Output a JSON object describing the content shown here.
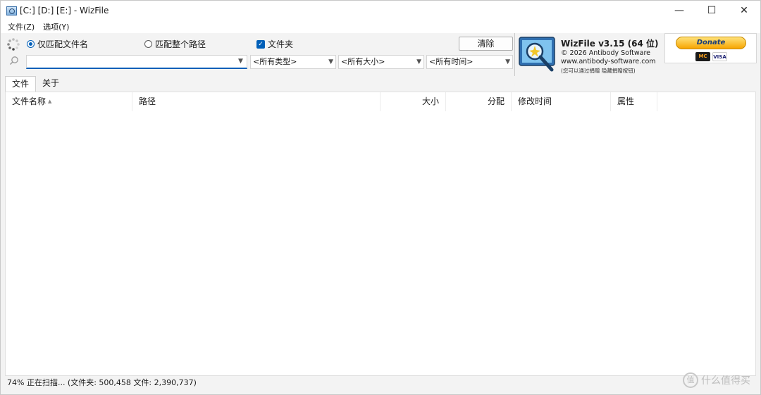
{
  "window": {
    "title": "[C:] [D:] [E:]  - WizFile",
    "controls": {
      "minimize": "—",
      "maximize": "☐",
      "close": "✕"
    }
  },
  "menu": {
    "items": [
      "文件(Z)",
      "选项(Y)"
    ]
  },
  "toolbar": {
    "radio_filename": "仅匹配文件名",
    "radio_fullpath": "匹配整个路径",
    "radio_selected": "filename",
    "folders_label": "文件夹",
    "folders_checked": true,
    "clear_button": "清除",
    "search_value": "",
    "filter_type": "<所有类型>",
    "filter_size": "<所有大小>",
    "filter_time": "<所有时间>"
  },
  "banner": {
    "title": "WizFile v3.15 (64 位)",
    "copyright": "© 2026 Antibody Software",
    "url": "www.antibody-software.com",
    "note": "(您可以通过捐赠 隐藏捐赠按钮)"
  },
  "donate": {
    "label": "Donate",
    "card1": "MC",
    "card2": "VISA"
  },
  "tabs": [
    {
      "label": "文件",
      "active": true
    },
    {
      "label": "关于",
      "active": false
    }
  ],
  "columns": {
    "name": "文件名称",
    "path": "路径",
    "size": "大小",
    "alloc": "分配",
    "modified": "修改时间",
    "attributes": "属性"
  },
  "rows": [],
  "status": {
    "text": "74% 正在扫描... (文件夹: 500,458  文件: 2,390,737)"
  },
  "watermark": {
    "glyph": "值",
    "text": "什么值得买"
  },
  "icons": {
    "spinner": "loading-spinner-icon",
    "search": "search-icon",
    "dropdown": "chevron-down-icon",
    "sort": "sort-ascending-icon"
  },
  "colors": {
    "accent": "#005fb8",
    "donate": "#f7a500"
  }
}
